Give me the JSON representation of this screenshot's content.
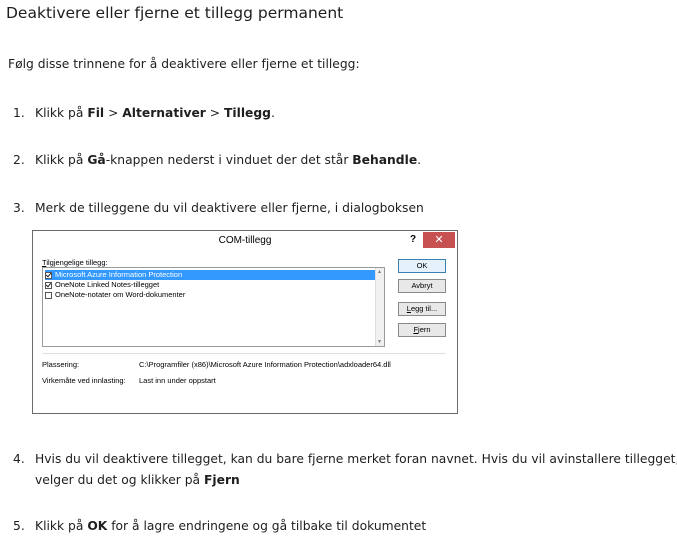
{
  "heading": "Deaktivere eller fjerne et tillegg permanent",
  "intro": "Følg disse trinnene for å deaktivere eller fjerne et tillegg:",
  "steps": [
    {
      "num": "1.",
      "parts": [
        "Klikk på ",
        "Fil",
        " > ",
        "Alternativer",
        " > ",
        "Tillegg",
        "."
      ]
    },
    {
      "num": "2.",
      "parts": [
        "Klikk på ",
        "Gå",
        "-knappen nederst i vinduet der det står ",
        "Behandle",
        "."
      ]
    },
    {
      "num": "3.",
      "text": "Merk de tilleggene du vil deaktivere eller fjerne, i dialogboksen"
    },
    {
      "num": "4.",
      "line1": "Hvis du vil deaktivere tillegget, kan du bare fjerne merket foran navnet. Hvis du vil avinstallere tillegget,",
      "line2a": "velger du det og klikker på ",
      "line2b": "Fjern"
    },
    {
      "num": "5.",
      "parts": [
        "Klikk på ",
        "OK",
        " for å lagre endringene og gå tilbake til dokumentet"
      ]
    }
  ],
  "dialog": {
    "title": "COM-tillegg",
    "help": "?",
    "close": "✕",
    "list_label_u": "T",
    "list_label_rest": "ilgjengelige tillegg:",
    "items": [
      {
        "label": "Microsoft Azure Information Protection",
        "checked": true,
        "selected": true
      },
      {
        "label": "OneNote Linked Notes-tillegget",
        "checked": true,
        "selected": false
      },
      {
        "label": "OneNote-notater om Word-dokumenter",
        "checked": false,
        "selected": false
      }
    ],
    "buttons": {
      "ok": "OK",
      "cancel": "Avbryt",
      "add_u": "L",
      "add_rest": "egg til...",
      "remove_u": "F",
      "remove_rest": "jern"
    },
    "location_label": "Plassering:",
    "location_value": "C:\\Programfiler (x86)\\Microsoft Azure Information Protection\\adxloader64.dll",
    "load_label": "Virkemåte ved innlasting:",
    "load_value": "Last inn under oppstart"
  }
}
